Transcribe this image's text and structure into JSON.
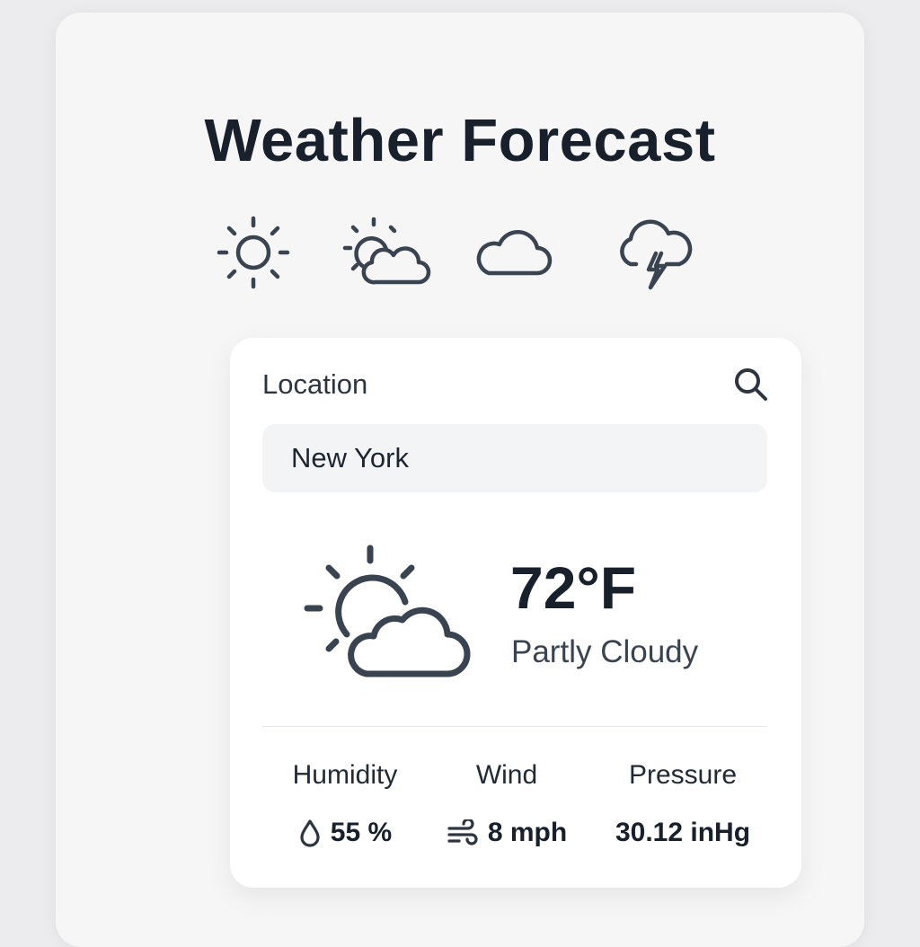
{
  "app": {
    "title": "Weather Forecast"
  },
  "icon_row": [
    "sun-icon",
    "partly-cloudy-icon",
    "cloud-icon",
    "thunderstorm-icon"
  ],
  "location": {
    "label": "Location",
    "value": "New York",
    "search_icon": "search-icon"
  },
  "current": {
    "icon": "partly-cloudy-icon",
    "temperature": "72°F",
    "condition": "Partly Cloudy"
  },
  "stats": {
    "humidity": {
      "label": "Humidity",
      "value": "55 %",
      "icon": "droplet-icon"
    },
    "wind": {
      "label": "Wind",
      "value": "8 mph",
      "icon": "wind-icon"
    },
    "pressure": {
      "label": "Pressure",
      "value": "30.12 inHg"
    }
  },
  "colors": {
    "background": "#ececee",
    "outer_card": "#f6f6f7",
    "inner_card": "#ffffff",
    "input_bg": "#f3f4f6",
    "icon_stroke": "#3a4350",
    "text_dark": "#18202b"
  }
}
